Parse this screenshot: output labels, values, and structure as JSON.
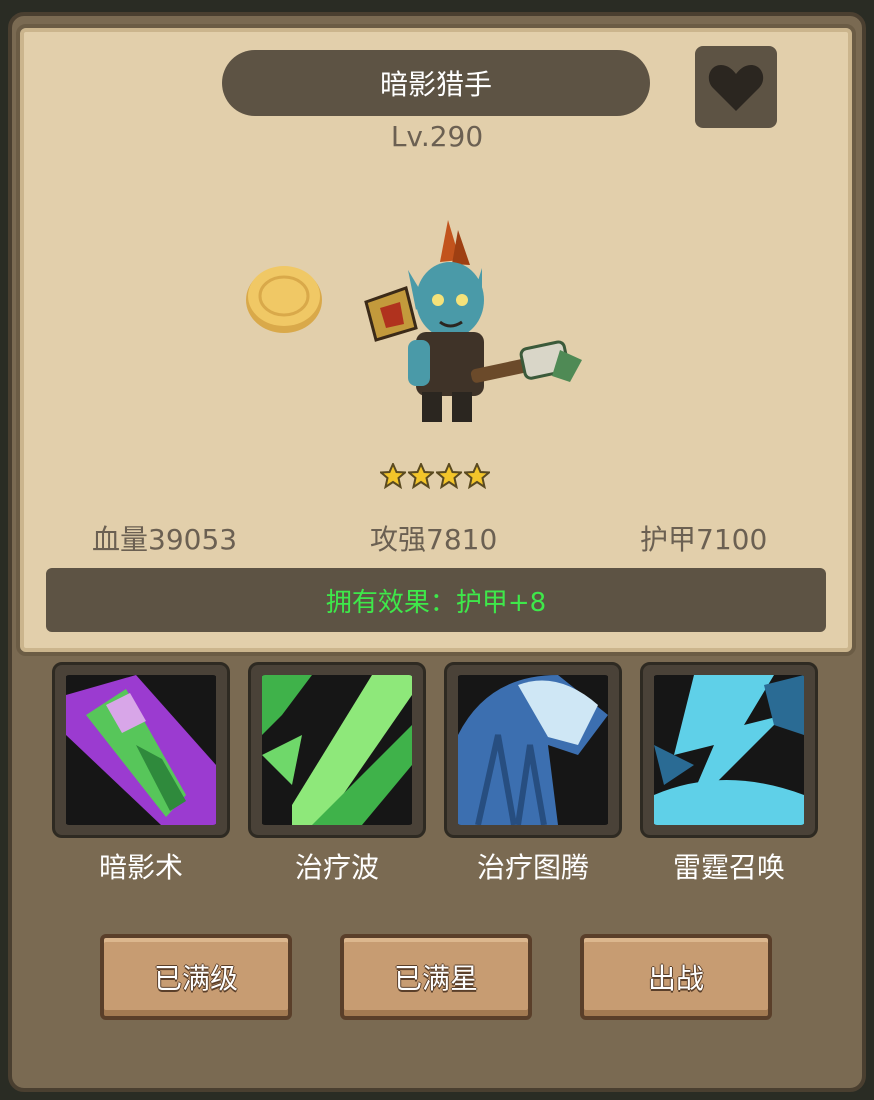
{
  "hero": {
    "name": "暗影猎手",
    "level": "Lv.290",
    "star_count": 4,
    "star_max": 4
  },
  "stats": {
    "hp": "血量39053",
    "attack": "攻强7810",
    "armor": "护甲7100"
  },
  "effect": {
    "text": "拥有效果：护甲+8",
    "color": "#3ee84a"
  },
  "skills": [
    {
      "label": "暗影术",
      "icon": "shadow-spell-icon"
    },
    {
      "label": "治疗波",
      "icon": "healing-wave-icon"
    },
    {
      "label": "治疗图腾",
      "icon": "healing-totem-icon"
    },
    {
      "label": "雷霆召唤",
      "icon": "thunder-summon-icon"
    }
  ],
  "buttons": {
    "max_level": "已满级",
    "max_star": "已满星",
    "deploy": "出战"
  },
  "icons": {
    "favorite": "heart-icon",
    "coin": "coin-icon",
    "star": "star-icon"
  },
  "colors": {
    "parchment": "#e2cfab",
    "banner": "#5d5344",
    "button_wood": "#c79c72"
  }
}
